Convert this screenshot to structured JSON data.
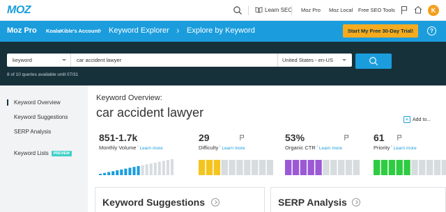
{
  "topnav": {
    "logo": "MOZ",
    "learn_seo": "Learn SEO",
    "links": [
      "Moz Pro",
      "Moz Local",
      "Free SEO Tools"
    ],
    "avatar_letter": "K"
  },
  "bluebar": {
    "product": "Moz Pro",
    "account": "KoalaKible's Account",
    "crumbs": [
      "Keyword Explorer",
      "Explore by Keyword"
    ],
    "trial_button": "Start My Free 30-Day Trial!",
    "help": "?"
  },
  "search": {
    "type": "keyword",
    "query": "car accident lawyer",
    "locale": "United States - en-US",
    "quota": "8 of 10 queries available until 07/31"
  },
  "sidebar": {
    "items": [
      "Keyword Overview",
      "Keyword Suggestions",
      "SERP Analysis",
      "Keyword Lists"
    ],
    "preview_badge": "PREVIEW"
  },
  "overview": {
    "label": "Keyword Overview:",
    "keyword": "car accident lawyer",
    "add_to": "Add to..."
  },
  "metrics": [
    {
      "value": "851-1.7k",
      "label": "Monthly Volume",
      "info": "i",
      "more": "Learn more",
      "level": 0.55,
      "color": "#1b9ddd"
    },
    {
      "value": "29",
      "label": "Difficulty",
      "info": "i",
      "more": "Learn more",
      "level": 0.29,
      "color": "#f4c51f"
    },
    {
      "value": "53%",
      "label": "Organic CTR",
      "info": "i",
      "more": "Learn more",
      "level": 0.53,
      "color": "#9b59d6"
    },
    {
      "value": "61",
      "label": "Priority",
      "info": "i",
      "more": "Learn more",
      "level": 0.5,
      "color": "#2ecc40"
    }
  ],
  "cards": [
    "Keyword Suggestions",
    "SERP Analysis"
  ]
}
